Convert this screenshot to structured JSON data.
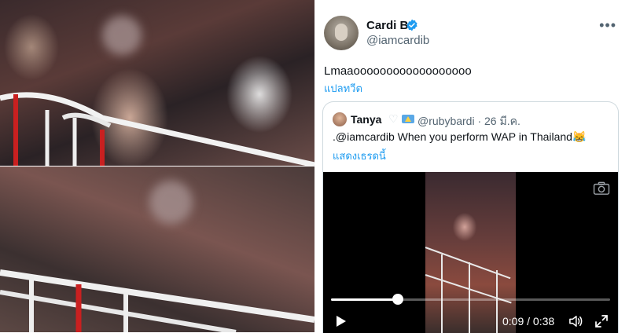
{
  "author": {
    "name": "Cardi B",
    "handle": "@iamcardib",
    "verified_color": "#1d9bf0",
    "more_icon": "more-horizontal-icon"
  },
  "tweet": {
    "text": "Lmaaoooooooooooooooooo",
    "translate_label": "แปลทวีต"
  },
  "quote": {
    "name": "Tanya",
    "handle": "@rubybardi · 26 มี.ค.",
    "text": ".@iamcardib When you perform WAP in Thailand😹",
    "show_thread_label": "แสดงเธรดนี้"
  },
  "video": {
    "elapsed": "0:09",
    "duration": "0:38",
    "time_label": "0:09 / 0:38",
    "progress_fraction": 0.24,
    "icons": [
      "play-icon",
      "volume-icon",
      "fullscreen-icon",
      "camera-icon"
    ]
  },
  "colors": {
    "link": "#1d9bf0",
    "secondary_text": "#536471",
    "border": "#cfd9de"
  }
}
